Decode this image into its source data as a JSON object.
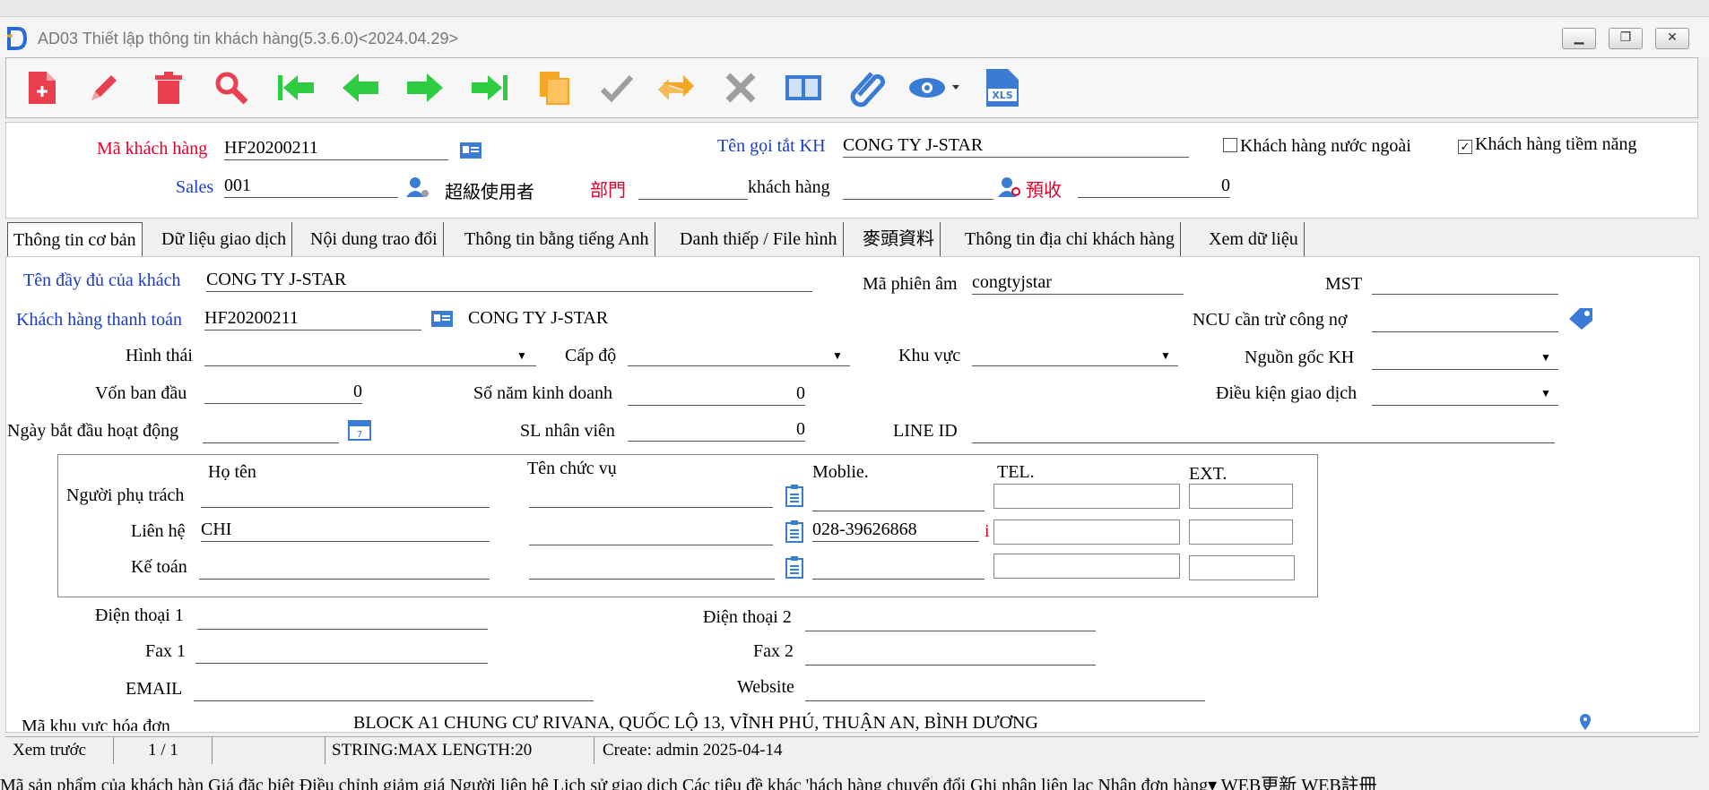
{
  "window": {
    "title": "AD03 Thiết lập thông tin khách hàng(5.3.6.0)<2024.04.29>",
    "controls": [
      "minimize-icon",
      "restore-icon",
      "close-icon"
    ]
  },
  "toolbar": {
    "buttons": [
      {
        "name": "new-record",
        "icon": "new-file-icon"
      },
      {
        "name": "edit",
        "icon": "pencil-icon"
      },
      {
        "name": "delete",
        "icon": "trash-icon"
      },
      {
        "name": "search",
        "icon": "search-icon"
      },
      {
        "name": "first",
        "icon": "first-record-icon"
      },
      {
        "name": "previous",
        "icon": "previous-icon"
      },
      {
        "name": "next",
        "icon": "next-icon"
      },
      {
        "name": "last",
        "icon": "last-record-icon"
      },
      {
        "name": "copy",
        "icon": "copy-icon"
      },
      {
        "name": "confirm",
        "icon": "check-icon"
      },
      {
        "name": "refresh",
        "icon": "refresh-icon"
      },
      {
        "name": "cancel",
        "icon": "cancel-icon"
      },
      {
        "name": "manual",
        "icon": "book-icon"
      },
      {
        "name": "attachment",
        "icon": "paperclip-icon"
      },
      {
        "name": "preview",
        "icon": "eye-icon"
      },
      {
        "name": "export-xls",
        "icon": "xls-icon",
        "label": "XLS"
      }
    ]
  },
  "header": {
    "customer_code_label": "Mã khách hàng",
    "customer_code": "HF20200211",
    "short_name_label": "Tên gọi tắt KH",
    "short_name": "CONG TY J-STAR",
    "foreign_customer_label": "Khách hàng nước ngoài",
    "foreign_customer_checked": false,
    "potential_customer_label": "Khách hàng tiềm năng",
    "potential_customer_checked": true,
    "sales_label": "Sales",
    "sales_code": "001",
    "sales_name": "超級使用者",
    "department_label": "部門",
    "department": "",
    "customer_type_label": "khách hàng",
    "customer_type": "",
    "prepaid_label": "預收",
    "prepaid": "0",
    "check_mark": "✓"
  },
  "tabs": [
    {
      "label": "Thông tin cơ bản",
      "active": true
    },
    {
      "label": "Dữ liệu giao dịch",
      "active": false
    },
    {
      "label": "Nội dung trao đổi",
      "active": false
    },
    {
      "label": "Thông tin bằng tiếng Anh",
      "active": false
    },
    {
      "label": "Danh thiếp / File hình",
      "active": false
    },
    {
      "label": "麥頭資料",
      "active": false
    },
    {
      "label": "Thông tin địa chỉ khách hàng",
      "active": false
    },
    {
      "label": "Xem dữ liệu",
      "active": false
    }
  ],
  "basic": {
    "full_name_label": "Tên đầy đủ của khách",
    "full_name": "CONG TY J-STAR",
    "phonetic_label": "Mã phiên âm",
    "phonetic": "congtyjstar",
    "tax_id_label": "MST",
    "tax_id": "",
    "billing_customer_label": "Khách hàng thanh toán",
    "billing_customer_code": "HF20200211",
    "billing_customer_name": "CONG TY J-STAR",
    "offset_supplier_label": "NCU cần trừ công nợ",
    "offset_supplier": "",
    "form_label": "Hình thái",
    "form": "",
    "level_label": "Cấp độ",
    "level": "",
    "region_label": "Khu vực",
    "region": "",
    "source_label": "Nguồn gốc KH",
    "source": "",
    "capital_label": "Vốn ban đầu",
    "capital": "0",
    "years_label": "Số năm kinh doanh",
    "years": "0",
    "trade_terms_label": "Điều kiện giao dịch",
    "trade_terms": "",
    "start_date_label": "Ngày bắt đầu hoạt động",
    "start_date": "",
    "employees_label": "SL nhân viên",
    "employees": "0",
    "line_id_label": "LINE ID",
    "line_id": ""
  },
  "contacts": {
    "headers": {
      "name": "Họ tên",
      "title": "Tên chức vụ",
      "mobile": "Moblie.",
      "tel": "TEL.",
      "ext": "EXT."
    },
    "rows": [
      {
        "role": "Người phụ trách",
        "name": "",
        "title": "",
        "mobile": "",
        "tel": "",
        "ext": ""
      },
      {
        "role": "Liên hệ",
        "name": "CHI",
        "title": "",
        "mobile": "028-39626868",
        "tel": "",
        "ext": "",
        "marker": "i"
      },
      {
        "role": "Kế toán",
        "name": "",
        "title": "",
        "mobile": "",
        "tel": "",
        "ext": ""
      }
    ]
  },
  "communication": {
    "phone1_label": "Điện thoại 1",
    "phone1": "",
    "phone2_label": "Điện thoại 2",
    "phone2": "",
    "fax1_label": "Fax 1",
    "fax1": "",
    "fax2_label": "Fax 2",
    "fax2": "",
    "email_label": "EMAIL",
    "email": "",
    "website_label": "Website",
    "website": "",
    "invoice_region_label": "Mã khu vực hóa đơn",
    "address": "BLOCK A1 CHUNG CƯ RIVANA, QUỐC LỘ 13, VĨNH PHÚ, THUẬN AN, BÌNH DƯƠNG"
  },
  "status": {
    "mode": "Xem trước",
    "page": "1 / 1",
    "blank": "",
    "field_info": "STRING:MAX LENGTH:20",
    "created": "Create: admin 2025-04-14"
  },
  "bottom_tabs": "Mã sản phẩm của khách hàn Giá đặc biệt Điều chỉnh giảm giá Người liên hệ Lịch sử giao dịch Các tiêu đề khác 'hách hàng chuyển đổi Ghi nhận liên lạc Nhận đơn hàng▾ WEB更新 WEB註冊",
  "colors": {
    "label_red": "#e3002b",
    "label_blue": "#1a3cc8",
    "icon_red": "#e8404e",
    "icon_green": "#2ecc40",
    "icon_orange": "#f5a623",
    "icon_blue": "#3a7bd5",
    "icon_gray": "#9e9e9e"
  }
}
